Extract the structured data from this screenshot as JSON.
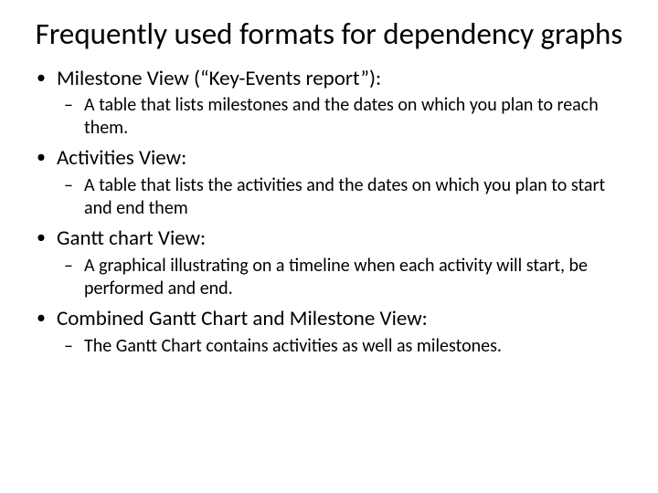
{
  "title": "Frequently used formats for dependency graphs",
  "items": [
    {
      "label": "Milestone View (“Key-Events report”):",
      "sub": "A table that lists milestones and the dates on which you plan to reach them."
    },
    {
      "label": "Activities View:",
      "sub": "A table that lists the activities and the dates on which you plan to start and end them"
    },
    {
      "label": "Gantt chart View:",
      "sub": "A graphical illustrating on a timeline when each activity will start, be performed and end."
    },
    {
      "label": "Combined Gantt Chart and Milestone View:",
      "sub": "The Gantt Chart contains activities as well as milestones."
    }
  ]
}
